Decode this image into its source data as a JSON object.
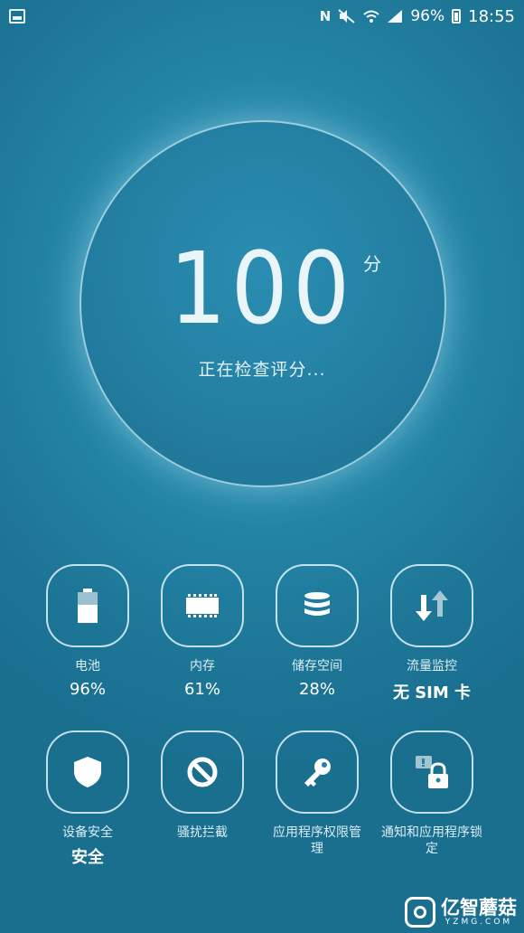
{
  "status_bar": {
    "nfc": "N",
    "battery_percent": "96%",
    "time": "18:55"
  },
  "score": {
    "value": "100",
    "unit": "分",
    "status": "正在检查评分..."
  },
  "tiles": [
    {
      "label": "电池",
      "value": "96%",
      "icon": "battery-icon"
    },
    {
      "label": "内存",
      "value": "61%",
      "icon": "memory-chip-icon"
    },
    {
      "label": "储存空间",
      "value": "28%",
      "icon": "storage-database-icon"
    },
    {
      "label": "流量监控",
      "value": "无 SIM 卡",
      "icon": "data-transfer-arrows-icon"
    },
    {
      "label": "设备安全",
      "value": "安全",
      "icon": "shield-icon"
    },
    {
      "label": "骚扰拦截",
      "value": "",
      "icon": "block-icon"
    },
    {
      "label": "应用程序权限管理",
      "value": "",
      "icon": "key-icon"
    },
    {
      "label": "通知和应用程序锁定",
      "value": "",
      "icon": "lock-icon"
    }
  ],
  "watermark": {
    "cn": "亿智蘑菇",
    "en": "YZMG.COM"
  },
  "colors": {
    "background": "#1e7798",
    "ring_border": "#d2f0f8",
    "text": "#ffffff"
  }
}
